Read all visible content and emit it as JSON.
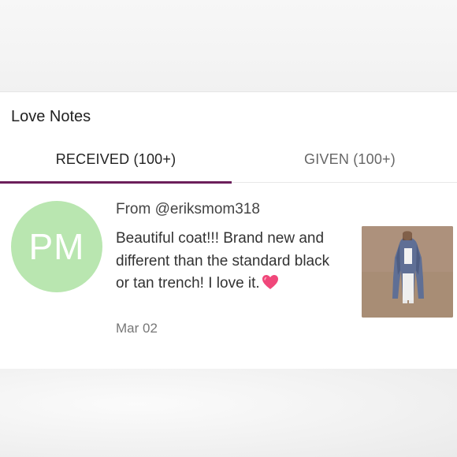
{
  "section": {
    "title": "Love Notes"
  },
  "tabs": [
    {
      "label": "RECEIVED (100+)",
      "active": true
    },
    {
      "label": "GIVEN (100+)",
      "active": false
    }
  ],
  "note": {
    "avatar_initials": "PM",
    "avatar_color": "#b9e6b0",
    "from": "From @eriksmom318",
    "message": "Beautiful coat!!! Brand new and different than the standard black or tan trench! I love it.",
    "emoji": "❤️",
    "date": "Mar 02"
  },
  "colors": {
    "accent": "#6c1f5b"
  }
}
